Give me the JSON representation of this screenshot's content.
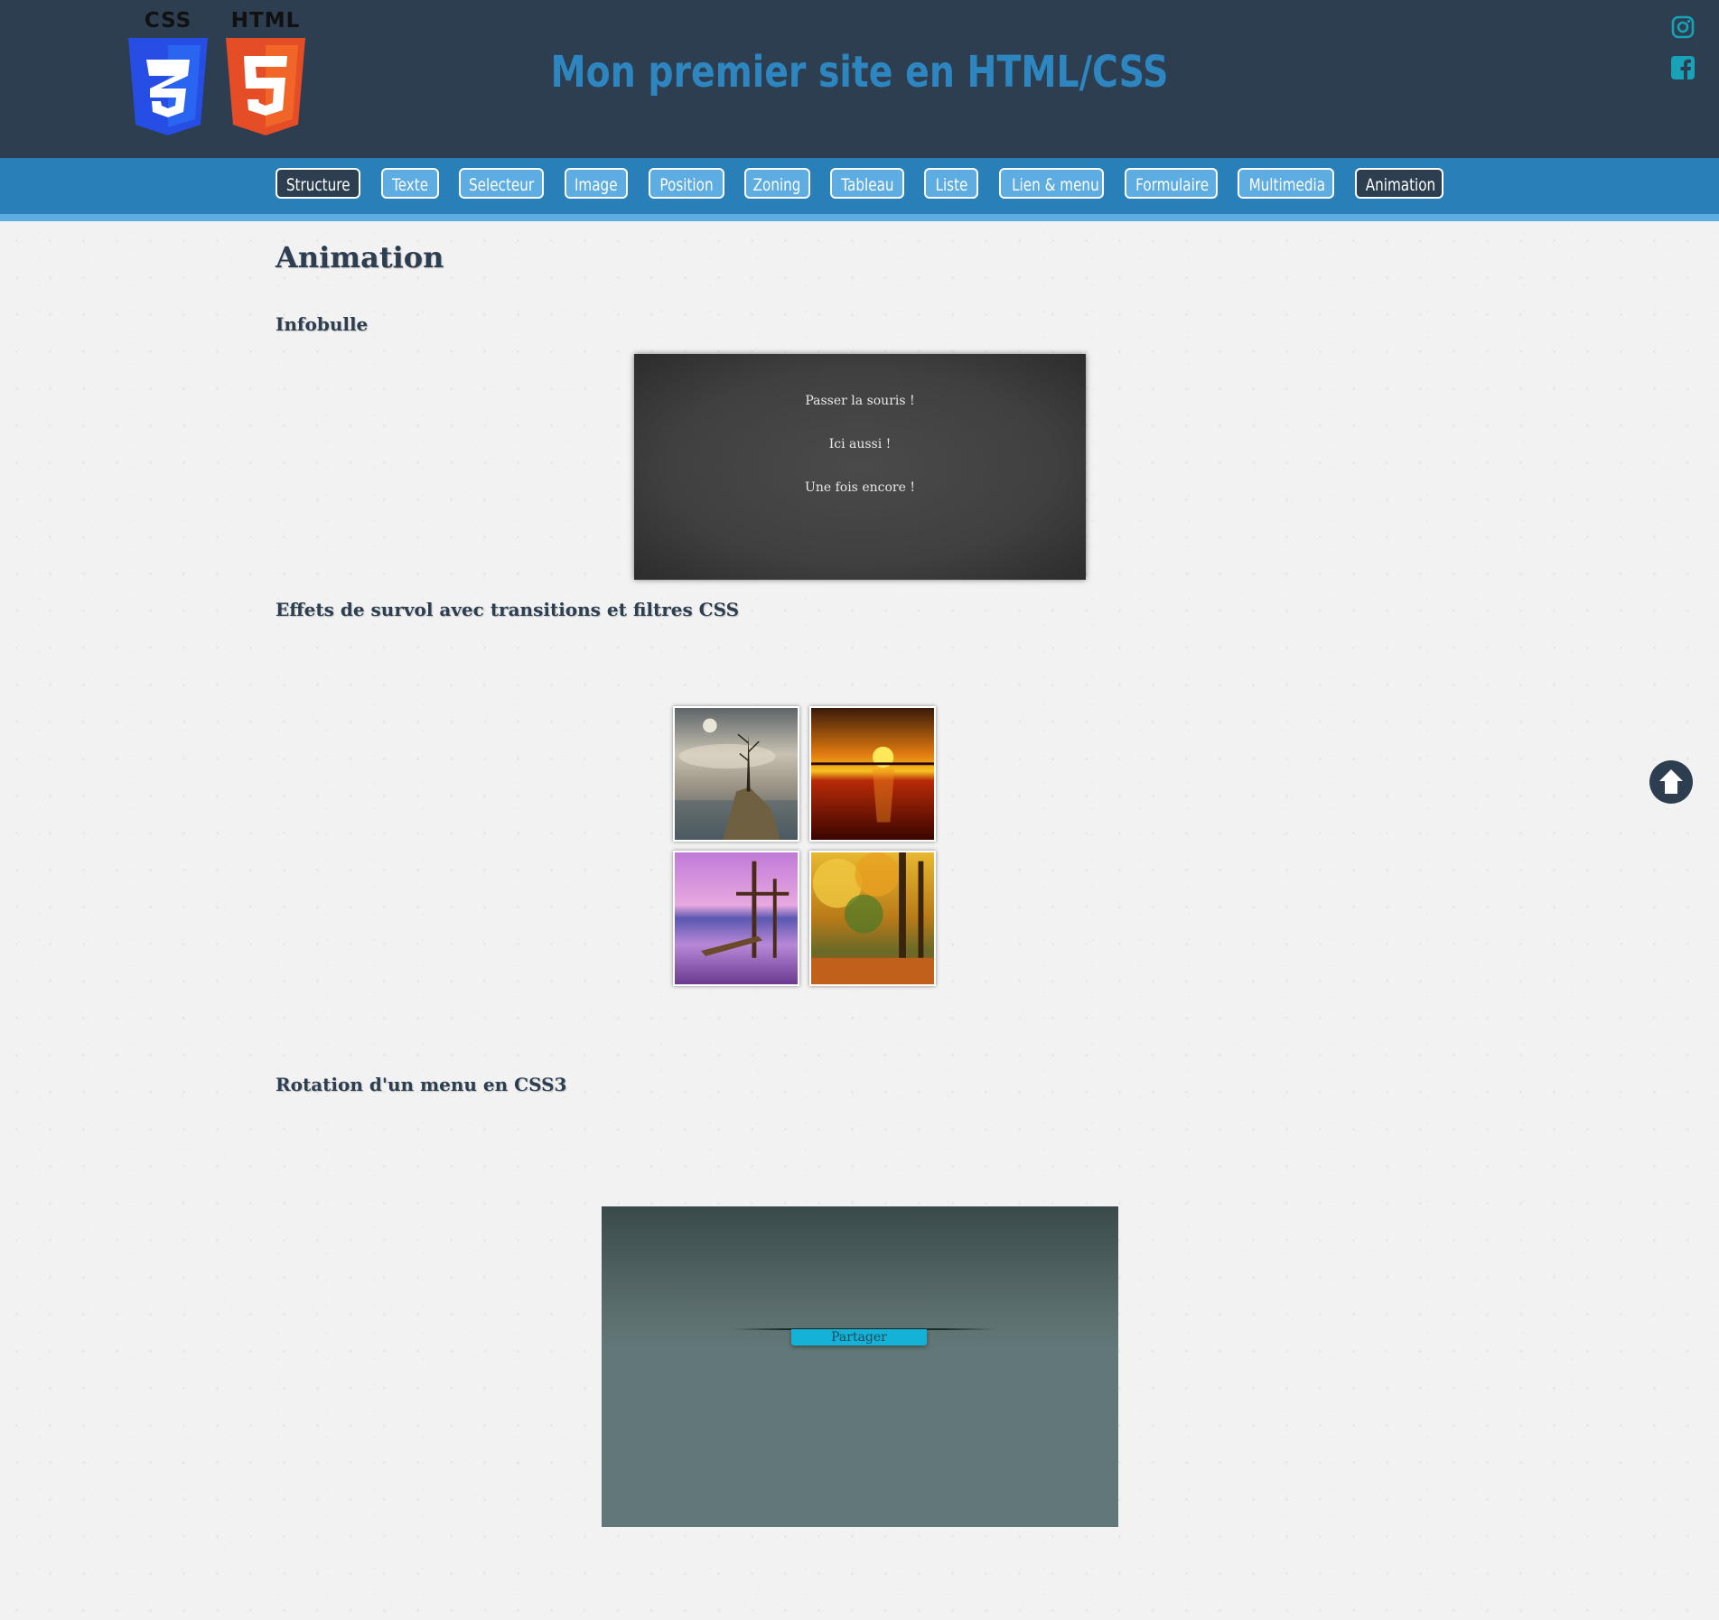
{
  "header": {
    "logos": [
      {
        "label": "CSS",
        "icon": "css3-shield-icon",
        "color": "#264de4"
      },
      {
        "label": "HTML",
        "icon": "html5-shield-icon",
        "color": "#e44d26"
      }
    ],
    "title": "Mon premier site en HTML/CSS",
    "title_color": "#2e86c1",
    "social": [
      "instagram-icon",
      "facebook-icon"
    ],
    "social_color": "#17a2b8",
    "background": "#2c3e50"
  },
  "nav": {
    "background": "#2980b9",
    "items": [
      {
        "label": "Structure",
        "active": true
      },
      {
        "label": "Texte",
        "active": false
      },
      {
        "label": "Selecteur",
        "active": false
      },
      {
        "label": "Image",
        "active": false
      },
      {
        "label": "Position",
        "active": false
      },
      {
        "label": "Zoning",
        "active": false
      },
      {
        "label": "Tableau",
        "active": false
      },
      {
        "label": "Liste",
        "active": false
      },
      {
        "label": "Lien & menu",
        "active": false
      },
      {
        "label": "Formulaire",
        "active": false
      },
      {
        "label": "Multimedia",
        "active": false
      },
      {
        "label": "Animation",
        "active": true
      }
    ]
  },
  "main": {
    "page_title": "Animation",
    "infobulle": {
      "heading": "Infobulle",
      "triggers": [
        "Passer la souris !",
        "Ici aussi !",
        "Une fois encore !"
      ]
    },
    "hover_effects": {
      "heading": "Effets de survol avec transitions et filtres CSS",
      "images": [
        "misty-tree-landscape",
        "sunset-over-sea",
        "purple-lake-pier",
        "autumn-forest"
      ]
    },
    "rotation_menu": {
      "heading": "Rotation d'un menu en CSS3",
      "button_label": "Partager"
    }
  },
  "back_to_top_icon": "arrow-up-circle-icon"
}
